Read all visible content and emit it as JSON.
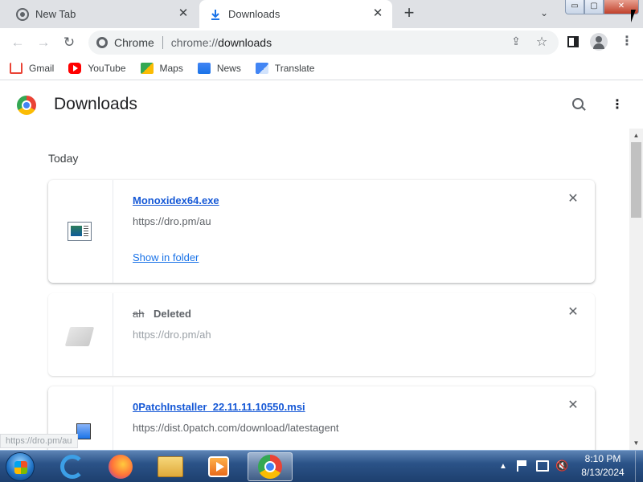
{
  "tabs": [
    {
      "label": "New Tab",
      "icon": "chrome-icon",
      "active": false
    },
    {
      "label": "Downloads",
      "icon": "download-icon",
      "active": true
    }
  ],
  "window_controls": {
    "minimize": "▭",
    "maximize": "▢",
    "close": "✕"
  },
  "toolbar": {
    "back": "←",
    "forward": "→",
    "reload": "↻",
    "site_chip": "Chrome",
    "url_scheme": "chrome://",
    "url_path": "downloads"
  },
  "bookmarks": [
    {
      "label": "Gmail",
      "icon": "gmail-icon"
    },
    {
      "label": "YouTube",
      "icon": "youtube-icon"
    },
    {
      "label": "Maps",
      "icon": "maps-icon"
    },
    {
      "label": "News",
      "icon": "news-icon"
    },
    {
      "label": "Translate",
      "icon": "translate-icon"
    }
  ],
  "page": {
    "title": "Downloads",
    "section": "Today"
  },
  "downloads": [
    {
      "name": "Monoxidex64.exe",
      "url": "https://dro.pm/au",
      "action": "Show in folder",
      "status": ""
    },
    {
      "name": "ah",
      "url": "https://dro.pm/ah",
      "action": "",
      "status": "Deleted"
    },
    {
      "name": "0PatchInstaller_22.11.11.10550.msi",
      "url": "https://dist.0patch.com/download/latestagent",
      "action": "",
      "status": ""
    }
  ],
  "status_bar": {
    "hover_url": "https://dro.pm/au"
  },
  "taskbar": {
    "apps": [
      "internet-explorer",
      "firefox",
      "file-explorer",
      "media-player",
      "chrome"
    ],
    "clock_time": "8:10 PM",
    "clock_date": "8/13/2024"
  },
  "colors": {
    "link": "#1a73e8",
    "tab_strip": "#dfe1e5",
    "taskbar": "#2b5388"
  }
}
